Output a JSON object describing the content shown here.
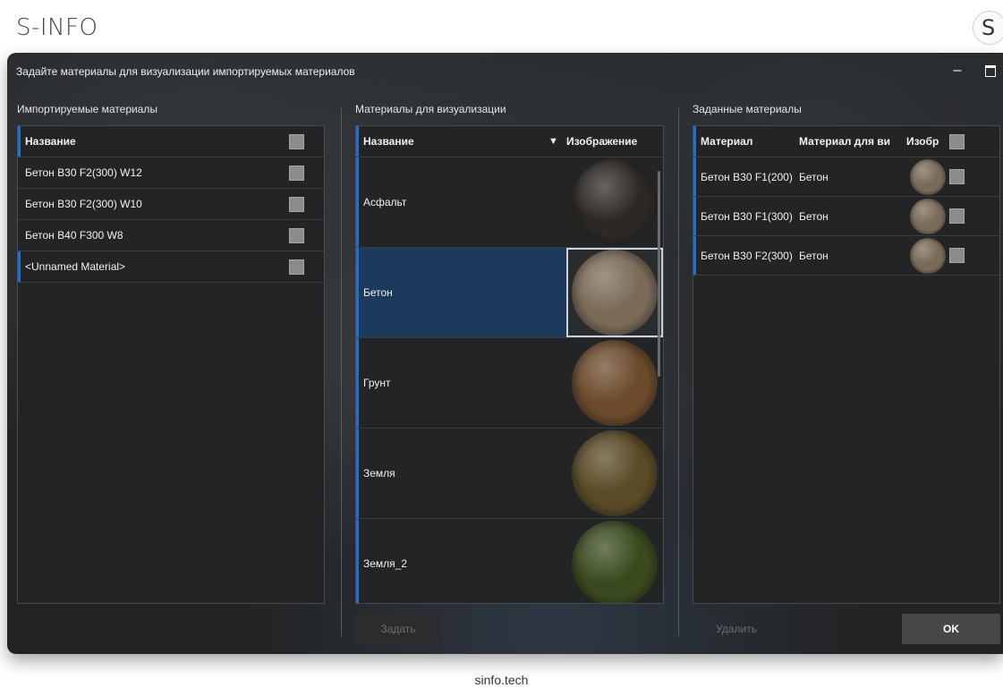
{
  "brand": {
    "name": "S-INFO",
    "logo_letter": "S"
  },
  "footer": {
    "text": "sinfo.tech"
  },
  "dialog": {
    "title": "Задайте материалы для визуализации импортируемых материалов",
    "controls": {
      "minimize": "–"
    },
    "imported": {
      "section_label": "Импортируемые материалы",
      "header": "Название",
      "items": [
        {
          "label": "Бетон B30 F2(300) W12"
        },
        {
          "label": "Бетон B30 F2(300) W10"
        },
        {
          "label": "Бетон B40 F300 W8"
        },
        {
          "label": "<Unnamed Material>"
        }
      ]
    },
    "visualization": {
      "section_label": "Материалы для визуализации",
      "header_name": "Название",
      "filter_icon": "filter-icon",
      "filter_glyph": "▼",
      "header_image": "Изображение",
      "selected_index": 1,
      "items": [
        {
          "label": "Асфальт",
          "color": "#2c2824"
        },
        {
          "label": "Бетон",
          "color": "#7a6a58"
        },
        {
          "label": "Грунт",
          "color": "#6b4a2c"
        },
        {
          "label": "Земля",
          "color": "#5a4a26"
        },
        {
          "label": "Земля_2",
          "color": "#3a4a1e"
        }
      ]
    },
    "assigned": {
      "section_label": "Заданные материалы",
      "headers": {
        "material": "Материал",
        "visual": "Материал для ви",
        "image": "Изобр"
      },
      "rows": [
        {
          "material": "Бетон B30 F1(200)",
          "visual": "Бетон",
          "color": "#7a6a58"
        },
        {
          "material": "Бетон B30 F1(300)",
          "visual": "Бетон",
          "color": "#7a6a58"
        },
        {
          "material": "Бетон B30 F2(300)",
          "visual": "Бетон",
          "color": "#7a6a58"
        }
      ]
    },
    "buttons": {
      "assign": "Задать",
      "delete": "Удалить",
      "ok": "OK"
    },
    "colors": {
      "accent": "#1e6fd6",
      "selection": "#1b3a5c",
      "background": "#222324"
    }
  }
}
